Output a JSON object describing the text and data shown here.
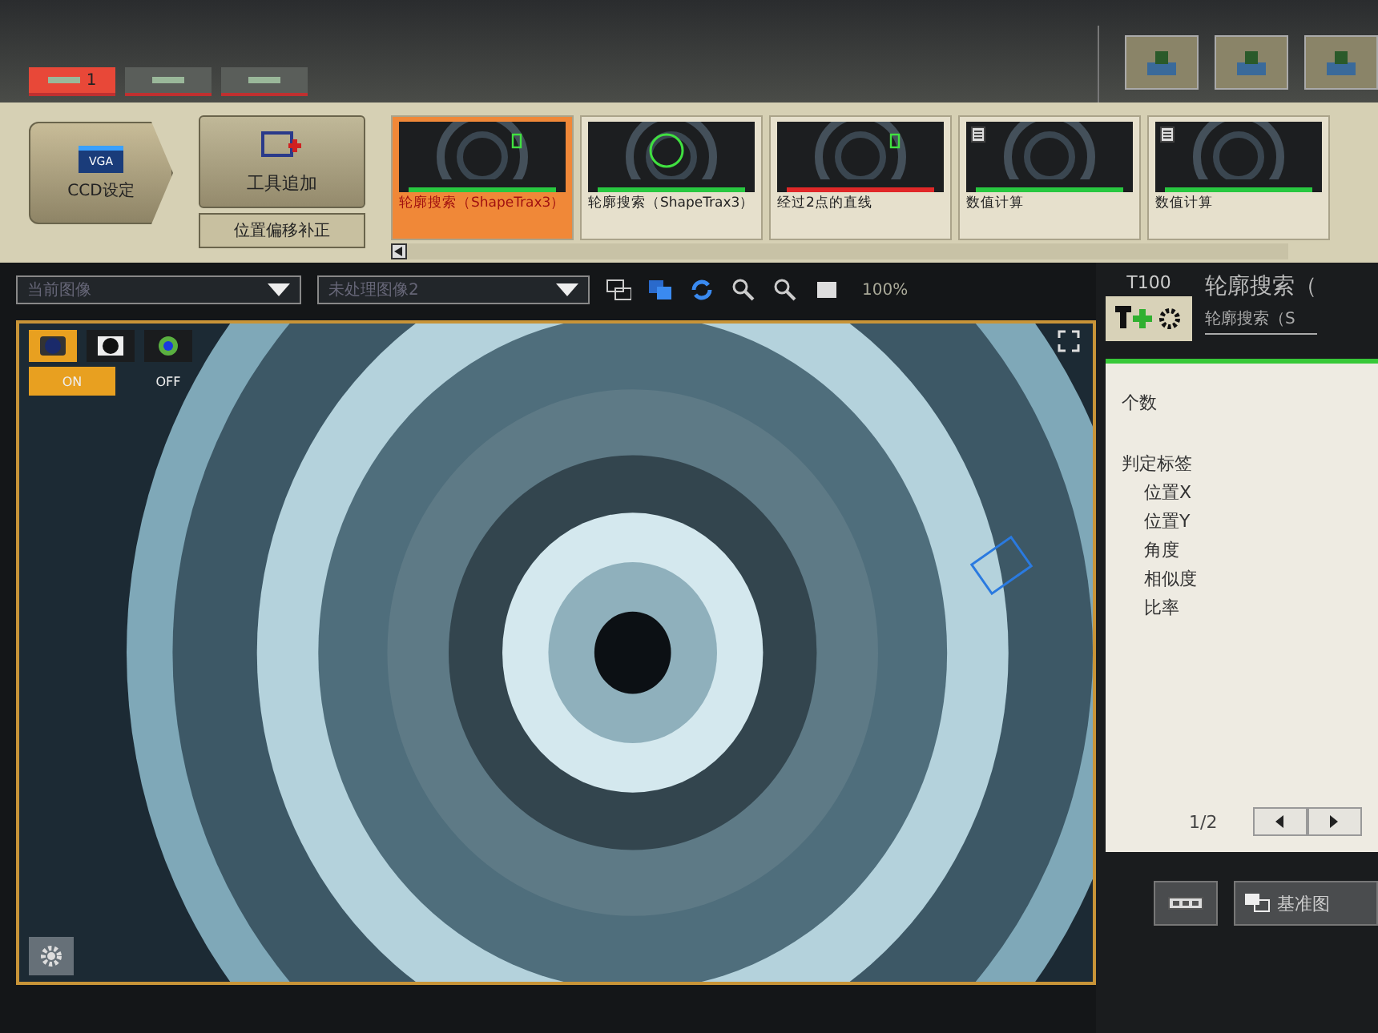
{
  "header": {
    "tabs": [
      {
        "label": "1",
        "selected": true
      },
      {
        "selected": false
      },
      {
        "selected": false
      }
    ]
  },
  "toolbar": {
    "ccd_button": {
      "badge": "VGA",
      "label": "CCD设定"
    },
    "add_tool_button": "工具追加",
    "offset_button": "位置偏移补正",
    "tools": [
      {
        "label": "轮廓搜索（ShapeTrax3）",
        "kind": "search",
        "selected": true,
        "ok": true
      },
      {
        "label": "轮廓搜索（ShapeTrax3）",
        "kind": "circle",
        "selected": false,
        "ok": true
      },
      {
        "label": "经过2点的直线",
        "kind": "search",
        "selected": false,
        "ok": false
      },
      {
        "label": "数值计算",
        "kind": "calc",
        "selected": false,
        "ok": true
      },
      {
        "label": "数值计算",
        "kind": "calc",
        "selected": false,
        "ok": true
      }
    ]
  },
  "view_bar": {
    "image_select": "当前图像",
    "process_select": "未处理图像2",
    "zoom": "100%"
  },
  "image_panel": {
    "modes": [
      {
        "kind": "filled",
        "selected": true
      },
      {
        "kind": "outline",
        "selected": false
      },
      {
        "kind": "ring",
        "selected": false
      }
    ],
    "overlay_toggle": [
      {
        "label": "ON",
        "selected": true
      },
      {
        "label": "OFF",
        "selected": false
      }
    ]
  },
  "detail_panel": {
    "tool_id": "T100",
    "title": "轮廓搜索（",
    "subtitle": "轮廓搜索（S",
    "rows": [
      {
        "label": "个数"
      },
      {
        "label": "判定标签",
        "children": [
          {
            "label": "位置X"
          },
          {
            "label": "位置Y"
          },
          {
            "label": "角度"
          },
          {
            "label": "相似度"
          },
          {
            "label": "比率"
          }
        ]
      }
    ],
    "page": "1/2"
  },
  "bottom_bar": {
    "reference_button": "基准图"
  }
}
